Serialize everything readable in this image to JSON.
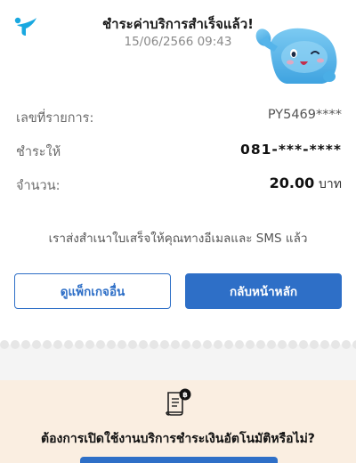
{
  "header": {
    "title": "ชำระค่าบริการสำเร็จแล้ว!",
    "datetime": "15/06/2566 09:43"
  },
  "details": [
    {
      "label": "เลขที่รายการ:",
      "value": "PY5469****"
    },
    {
      "label": "ชำระให้",
      "value": "081-***-****"
    },
    {
      "label": "จำนวน:",
      "amount": "20.00",
      "unit": "บาท"
    }
  ],
  "notice": "เราส่งสำเนาใบเสร็จให้คุณทางอีเมลและ SMS แล้ว",
  "buttons": {
    "other_packages": "ดูแพ็กเกจอื่น",
    "back_home": "กลับหน้าหลัก"
  },
  "promo": {
    "question": "ต้องการเปิดใช้งานบริการชำระเงินอัตโนมัติหรือไม่?",
    "icon": "receipt-baht-icon"
  },
  "colors": {
    "accent": "#2e6fc7",
    "logo": "#19a8e0",
    "promo_bg": "#faeee1",
    "mascot": "#5bb8ec"
  }
}
